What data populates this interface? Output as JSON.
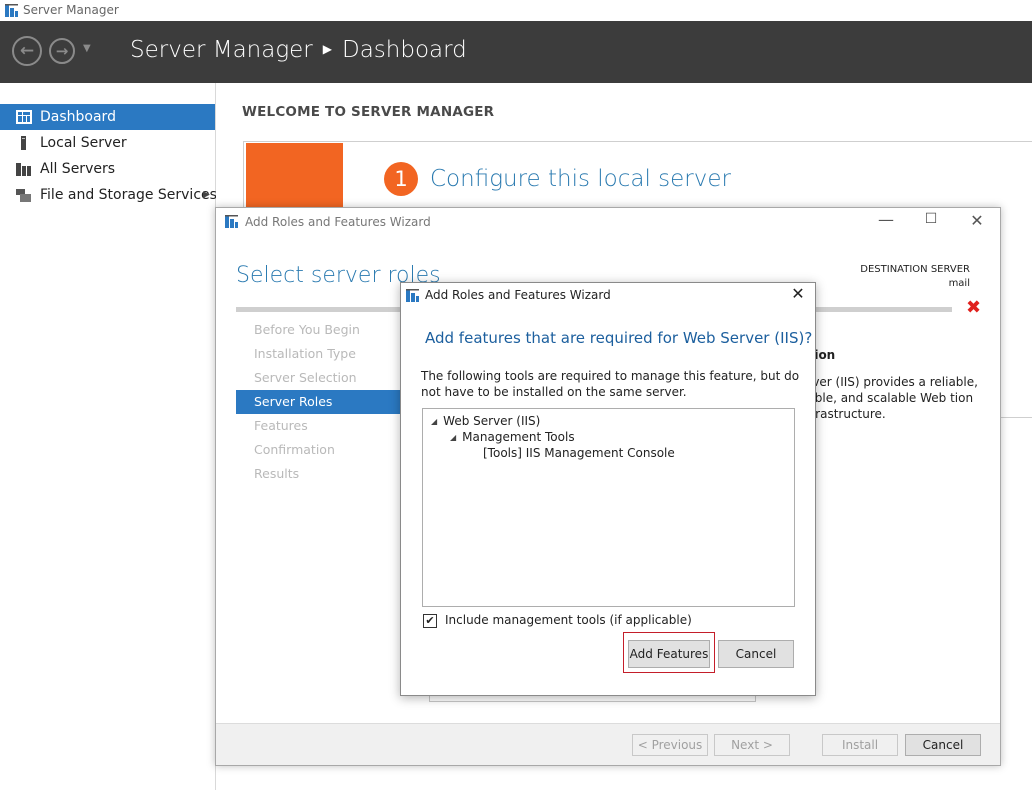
{
  "sm_window": {
    "title": "Server Manager",
    "header": {
      "app": "Server Manager",
      "page": "Dashboard"
    }
  },
  "sidebar": {
    "items": [
      {
        "label": "Dashboard",
        "icon": "dashboard-grid-icon",
        "active": true
      },
      {
        "label": "Local Server",
        "icon": "server-icon",
        "active": false
      },
      {
        "label": "All Servers",
        "icon": "servers-icon",
        "active": false
      },
      {
        "label": "File and Storage Services",
        "icon": "storage-icon",
        "active": false,
        "has_submenu": true
      }
    ]
  },
  "dashboard": {
    "welcome": "WELCOME TO SERVER MANAGER",
    "step_number": "1",
    "configure_link": "Configure this local server"
  },
  "wizard": {
    "title": "Add Roles and Features Wizard",
    "heading": "Select server roles",
    "destination_label": "DESTINATION SERVER",
    "destination_value": "mail",
    "steps": [
      {
        "label": "Before You Begin",
        "active": false
      },
      {
        "label": "Installation Type",
        "active": false
      },
      {
        "label": "Server Selection",
        "active": false
      },
      {
        "label": "Server Roles",
        "active": true
      },
      {
        "label": "Features",
        "active": false
      },
      {
        "label": "Confirmation",
        "active": false
      },
      {
        "label": "Results",
        "active": false
      }
    ],
    "description_title": "ption",
    "description_text": "erver (IIS) provides a reliable, eable, and scalable Web tion infrastructure.",
    "footer": {
      "previous": "< Previous",
      "next": "Next >",
      "install": "Install",
      "cancel": "Cancel"
    }
  },
  "dialog": {
    "title": "Add Roles and Features Wizard",
    "heading": "Add features that are required for Web Server (IIS)?",
    "body": "The following tools are required to manage this feature, but do not have to be installed on the same server.",
    "tree": [
      {
        "label": "Web Server (IIS)",
        "level": 0,
        "expanded": true
      },
      {
        "label": "Management Tools",
        "level": 1,
        "expanded": true
      },
      {
        "label": "[Tools] IIS Management Console",
        "level": 2
      }
    ],
    "include_tools_label": "Include management tools (if applicable)",
    "include_tools_checked": true,
    "add_features_button": "Add Features",
    "cancel_button": "Cancel"
  },
  "colors": {
    "header_bg": "#3c3c3c",
    "accent_blue": "#2b79c2",
    "tile_orange": "#f26522",
    "link_blue": "#2a7ab0",
    "error_red": "#e0201c",
    "focus_red": "#c41e2a"
  }
}
